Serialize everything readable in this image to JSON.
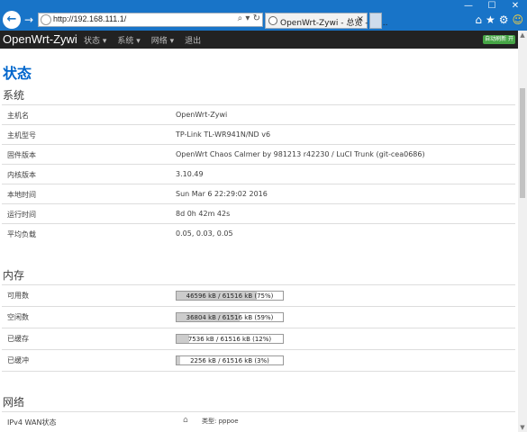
{
  "browser": {
    "url": "http://192.168.111.1/",
    "address_tools": "⌕ ▾ ↻",
    "tab_title": "OpenWrt-Zywi - 总览 - Lu...",
    "tab_close": "×",
    "back_glyph": "←",
    "forward_glyph": "→",
    "window_controls": [
      "—",
      "☐",
      "✕"
    ],
    "right_tools": [
      "⌂",
      "★",
      "⚙",
      "☺"
    ]
  },
  "header": {
    "brand": "OpenWrt-Zywi",
    "menu": [
      "状态 ▾",
      "系统 ▾",
      "网络 ▾",
      "退出"
    ],
    "refresh_badge": "自动刷新 开"
  },
  "page": {
    "title": "状态",
    "system": {
      "heading": "系统",
      "rows": [
        {
          "label": "主机名",
          "value": "OpenWrt-Zywi"
        },
        {
          "label": "主机型号",
          "value": "TP-Link TL-WR941N/ND v6"
        },
        {
          "label": "固件版本",
          "value": "OpenWrt Chaos Calmer by 981213 r42230 / LuCI Trunk (git-cea0686)"
        },
        {
          "label": "内核版本",
          "value": "3.10.49"
        },
        {
          "label": "本地时间",
          "value": "Sun Mar 6 22:29:02 2016"
        },
        {
          "label": "运行时间",
          "value": "8d 0h 42m 42s"
        },
        {
          "label": "平均负载",
          "value": "0.05, 0.03, 0.05"
        }
      ]
    },
    "memory": {
      "heading": "内存",
      "rows": [
        {
          "label": "可用数",
          "text": "46596 kB / 61516 kB (75%)",
          "percent": 75
        },
        {
          "label": "空闲数",
          "text": "36804 kB / 61516 kB (59%)",
          "percent": 59
        },
        {
          "label": "已缓存",
          "text": "7536 kB / 61516 kB (12%)",
          "percent": 12
        },
        {
          "label": "已缓冲",
          "text": "2256 kB / 61516 kB (3%)",
          "percent": 3
        }
      ]
    },
    "network": {
      "heading": "网络",
      "wan_label": "IPv4 WAN状态",
      "wan_type": "类型: pppoe"
    }
  }
}
